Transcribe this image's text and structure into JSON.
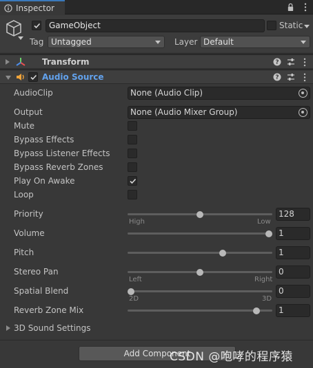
{
  "tab": {
    "label": "Inspector"
  },
  "header": {
    "name": "GameObject",
    "active": true,
    "static_label": "Static",
    "static_checked": false,
    "tag_label": "Tag",
    "tag_value": "Untagged",
    "layer_label": "Layer",
    "layer_value": "Default"
  },
  "components": {
    "transform": {
      "title": "Transform",
      "expanded": false
    },
    "audio_source": {
      "title": "Audio Source",
      "expanded": true,
      "enabled": true
    }
  },
  "properties": {
    "audio_clip": {
      "label": "AudioClip",
      "value": "None (Audio Clip)"
    },
    "output": {
      "label": "Output",
      "value": "None (Audio Mixer Group)"
    },
    "mute": {
      "label": "Mute",
      "checked": false
    },
    "bypass_effects": {
      "label": "Bypass Effects",
      "checked": false
    },
    "bypass_listener_effects": {
      "label": "Bypass Listener Effects",
      "checked": false
    },
    "bypass_reverb_zones": {
      "label": "Bypass Reverb Zones",
      "checked": false
    },
    "play_on_awake": {
      "label": "Play On Awake",
      "checked": true
    },
    "loop": {
      "label": "Loop",
      "checked": false
    },
    "priority": {
      "label": "Priority",
      "value": "128",
      "min": 0,
      "max": 256,
      "left_caption": "High",
      "right_caption": "Low"
    },
    "volume": {
      "label": "Volume",
      "value": "1",
      "min": 0,
      "max": 1
    },
    "pitch": {
      "label": "Pitch",
      "value": "1",
      "min": -3,
      "max": 3
    },
    "stereo_pan": {
      "label": "Stereo Pan",
      "value": "0",
      "min": -1,
      "max": 1,
      "left_caption": "Left",
      "right_caption": "Right"
    },
    "spatial_blend": {
      "label": "Spatial Blend",
      "value": "0",
      "min": 0,
      "max": 1,
      "left_caption": "2D",
      "right_caption": "3D"
    },
    "reverb_zone_mix": {
      "label": "Reverb Zone Mix",
      "value": "1",
      "min": 0,
      "max": 1.1
    }
  },
  "sound_settings": {
    "label": "3D Sound Settings"
  },
  "add_component": {
    "label": "Add Component"
  },
  "watermark": "CSDN @咆哮的程序猿"
}
